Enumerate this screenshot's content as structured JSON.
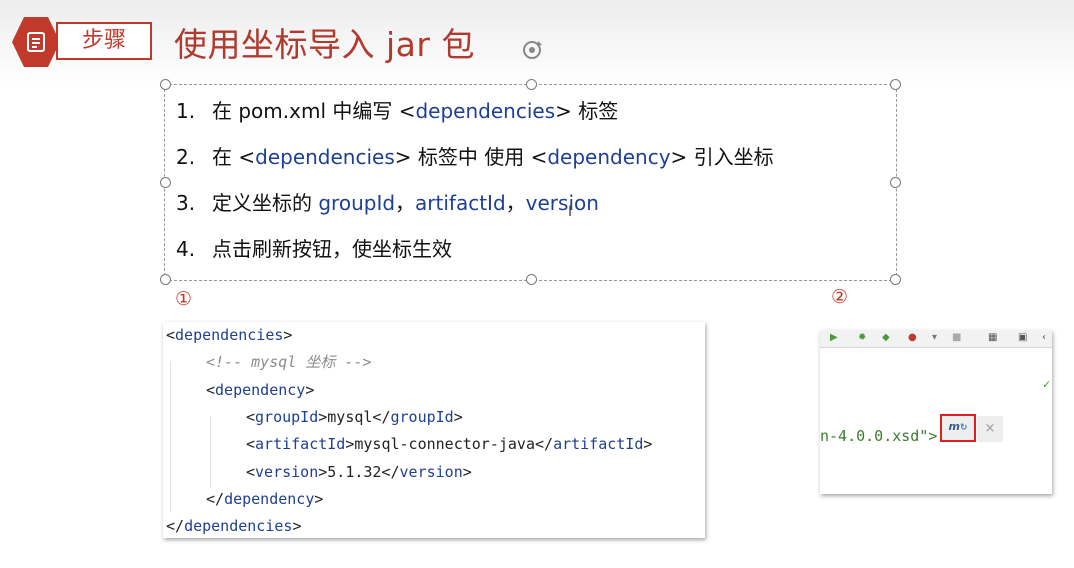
{
  "header": {
    "badge_label": "步骤",
    "title": "使用坐标导入 jar 包"
  },
  "steps": [
    {
      "num": "1.",
      "parts": [
        {
          "text": "在 pom.xml 中编写 <",
          "blue": false
        },
        {
          "text": "dependencies",
          "blue": true
        },
        {
          "text": "> 标签",
          "blue": false
        }
      ]
    },
    {
      "num": "2.",
      "parts": [
        {
          "text": "在 <",
          "blue": false
        },
        {
          "text": "dependencies",
          "blue": true
        },
        {
          "text": "> 标签中 使用 <",
          "blue": false
        },
        {
          "text": "dependency",
          "blue": true
        },
        {
          "text": "> 引入坐标",
          "blue": false
        }
      ]
    },
    {
      "num": "3.",
      "parts": [
        {
          "text": "定义坐标的 ",
          "blue": false
        },
        {
          "text": "groupId",
          "blue": true
        },
        {
          "text": "，",
          "blue": false
        },
        {
          "text": "artifactId",
          "blue": true
        },
        {
          "text": "，",
          "blue": false
        },
        {
          "text": "version",
          "blue": true
        }
      ]
    },
    {
      "num": "4.",
      "parts": [
        {
          "text": "点击刷新按钮，使坐标生效",
          "blue": false
        }
      ]
    }
  ],
  "markers": {
    "first": "①",
    "second": "②"
  },
  "code": {
    "lines": [
      {
        "indent": 0,
        "parts": [
          {
            "t": "<",
            "c": "p"
          },
          {
            "t": "dependencies",
            "c": "tag"
          },
          {
            "t": ">",
            "c": "p"
          }
        ]
      },
      {
        "indent": 1,
        "parts": [
          {
            "t": "<!-- mysql 坐标 -->",
            "c": "cmt"
          }
        ]
      },
      {
        "indent": 1,
        "parts": [
          {
            "t": "<",
            "c": "p"
          },
          {
            "t": "dependency",
            "c": "tag"
          },
          {
            "t": ">",
            "c": "p"
          }
        ]
      },
      {
        "indent": 2,
        "parts": [
          {
            "t": "<",
            "c": "p"
          },
          {
            "t": "groupId",
            "c": "tag"
          },
          {
            "t": ">mysql</",
            "c": "p"
          },
          {
            "t": "groupId",
            "c": "tag"
          },
          {
            "t": ">",
            "c": "p"
          }
        ]
      },
      {
        "indent": 2,
        "parts": [
          {
            "t": "<",
            "c": "p"
          },
          {
            "t": "artifactId",
            "c": "tag"
          },
          {
            "t": ">mysql-connector-java</",
            "c": "p"
          },
          {
            "t": "artifactId",
            "c": "tag"
          },
          {
            "t": ">",
            "c": "p"
          }
        ]
      },
      {
        "indent": 2,
        "parts": [
          {
            "t": "<",
            "c": "p"
          },
          {
            "t": "version",
            "c": "tag"
          },
          {
            "t": ">5.1.32</",
            "c": "p"
          },
          {
            "t": "version",
            "c": "tag"
          },
          {
            "t": ">",
            "c": "p"
          }
        ]
      },
      {
        "indent": 1,
        "parts": [
          {
            "t": "</",
            "c": "p"
          },
          {
            "t": "dependency",
            "c": "tag"
          },
          {
            "t": ">",
            "c": "p"
          }
        ]
      },
      {
        "indent": 0,
        "parts": [
          {
            "t": "</",
            "c": "p"
          },
          {
            "t": "dependencies",
            "c": "tag"
          },
          {
            "t": ">",
            "c": "p"
          }
        ]
      }
    ]
  },
  "ide": {
    "xsd_text": "n-4.0.0.xsd\">",
    "maven_button": "m",
    "close_button": "×"
  },
  "colors": {
    "accent": "#c0392b",
    "tag_blue": "#1f3f93",
    "comment": "#8c8c8c"
  }
}
